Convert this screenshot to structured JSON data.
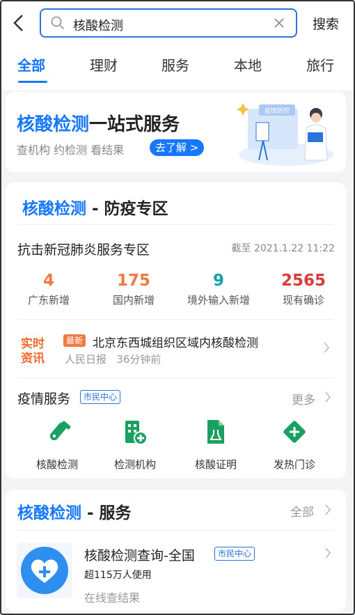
{
  "header": {
    "search_value": "核酸检测",
    "search_button": "搜索",
    "tabs": [
      "全部",
      "理财",
      "服务",
      "本地",
      "旅行"
    ],
    "active_tab": 0
  },
  "banner": {
    "title_highlight": "核酸检测",
    "title_rest": "一站式服务",
    "subtitle": "查机构 约检测 看结果",
    "cta": "去了解 >",
    "illustration_text": "疫情防控"
  },
  "epidemic": {
    "title_highlight": "核酸检测",
    "title_rest": " - 防疫专区",
    "subtitle": "抗击新冠肺炎服务专区",
    "as_of": "截至 2021.1.22 11:22",
    "stats": [
      {
        "value": "4",
        "label": "广东新增",
        "color": "#f07a3f"
      },
      {
        "value": "175",
        "label": "国内新增",
        "color": "#f07a3f"
      },
      {
        "value": "9",
        "label": "境外输入新增",
        "color": "#1aa0a8"
      },
      {
        "value": "2565",
        "label": "现有确诊",
        "color": "#d93a3a"
      }
    ],
    "news": {
      "logo_text": [
        "实时",
        "资讯"
      ],
      "badge": "最新",
      "title": "北京东西城组织区域内核酸检测",
      "source": "人民日报",
      "time": "36分钟前"
    },
    "services": {
      "title": "疫情服务",
      "tag": "市民中心",
      "more": "更多",
      "items": [
        {
          "label": "核酸检测",
          "icon": "test-tube-icon"
        },
        {
          "label": "检测机构",
          "icon": "hospital-building-icon"
        },
        {
          "label": "核酸证明",
          "icon": "certificate-file-icon"
        },
        {
          "label": "发热门诊",
          "icon": "medical-cross-diamond-icon"
        }
      ]
    }
  },
  "service_card": {
    "title_highlight": "核酸检测",
    "title_rest": " - 服务",
    "all": "全部",
    "program_title": "核酸检测查询-全国",
    "program_tag": "市民中心",
    "users": "超115万人使用",
    "desc": "在线查结果",
    "icon": "heart-plus-icon"
  },
  "colors": {
    "accent": "#1677ff",
    "green": "#1aa060"
  }
}
